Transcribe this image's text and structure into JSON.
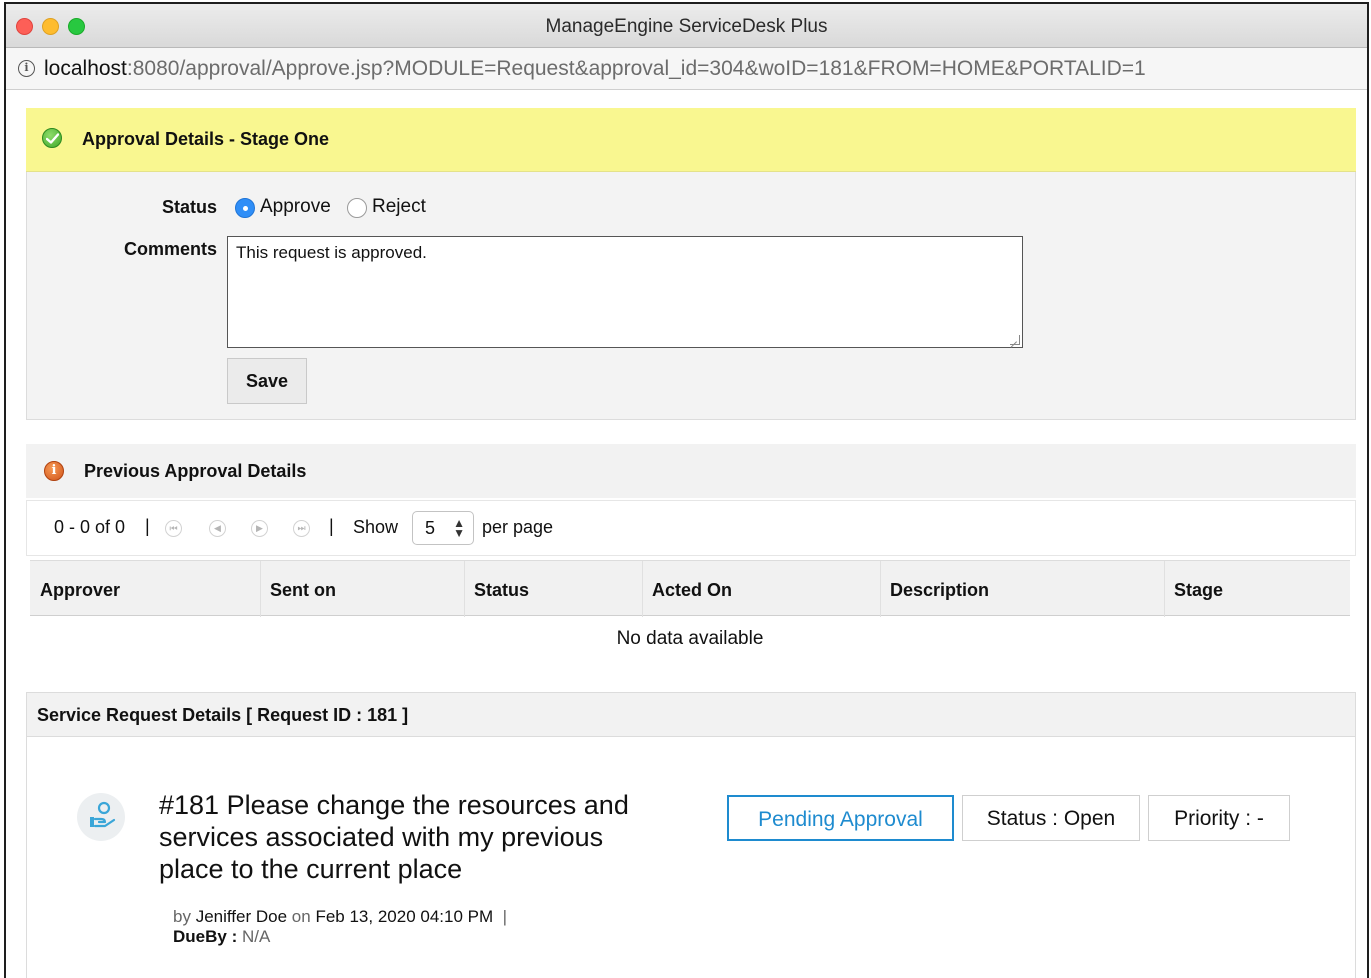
{
  "window": {
    "title": "ManageEngine ServiceDesk Plus",
    "url_host": "localhost",
    "url_rest": ":8080/approval/Approve.jsp?MODULE=Request&approval_id=304&woID=181&FROM=HOME&PORTALID=1"
  },
  "approval": {
    "title": "Approval Details - Stage One",
    "status_label": "Status",
    "approve_label": "Approve",
    "reject_label": "Reject",
    "selected": "Approve",
    "comments_label": "Comments",
    "comments_value": "This request is approved.",
    "save_label": "Save"
  },
  "previous": {
    "title": "Previous Approval Details",
    "range": "0 - 0 of 0",
    "separator": "|",
    "show_label": "Show",
    "per_page_value": "5",
    "per_page_label": "per page",
    "columns": [
      "Approver",
      "Sent on",
      "Status",
      "Acted On",
      "Description",
      "Stage"
    ],
    "empty_text": "No data available"
  },
  "service_request": {
    "header": "Service Request Details [ Request ID : 181 ]",
    "title": "#181  Please change the resources and services associated with my previous place to the current place",
    "by_label": "by",
    "requester": "Jeniffer Doe",
    "on_label": "on",
    "date": "Feb 13, 2020 04:10 PM",
    "meta_sep": "|",
    "dueby_label": "DueBy :",
    "dueby_value": "N/A",
    "pending_label": "Pending Approval",
    "status_label": "Status : Open",
    "priority_label": "Priority : -"
  },
  "colors": {
    "approval_header_bg": "#f9f790",
    "radio_selected": "#2f8ef7",
    "pending_accent": "#1e8bcf"
  },
  "icons": {
    "approval": "check-circle-icon",
    "previous": "info-circle-icon",
    "request": "request-hand-icon"
  }
}
